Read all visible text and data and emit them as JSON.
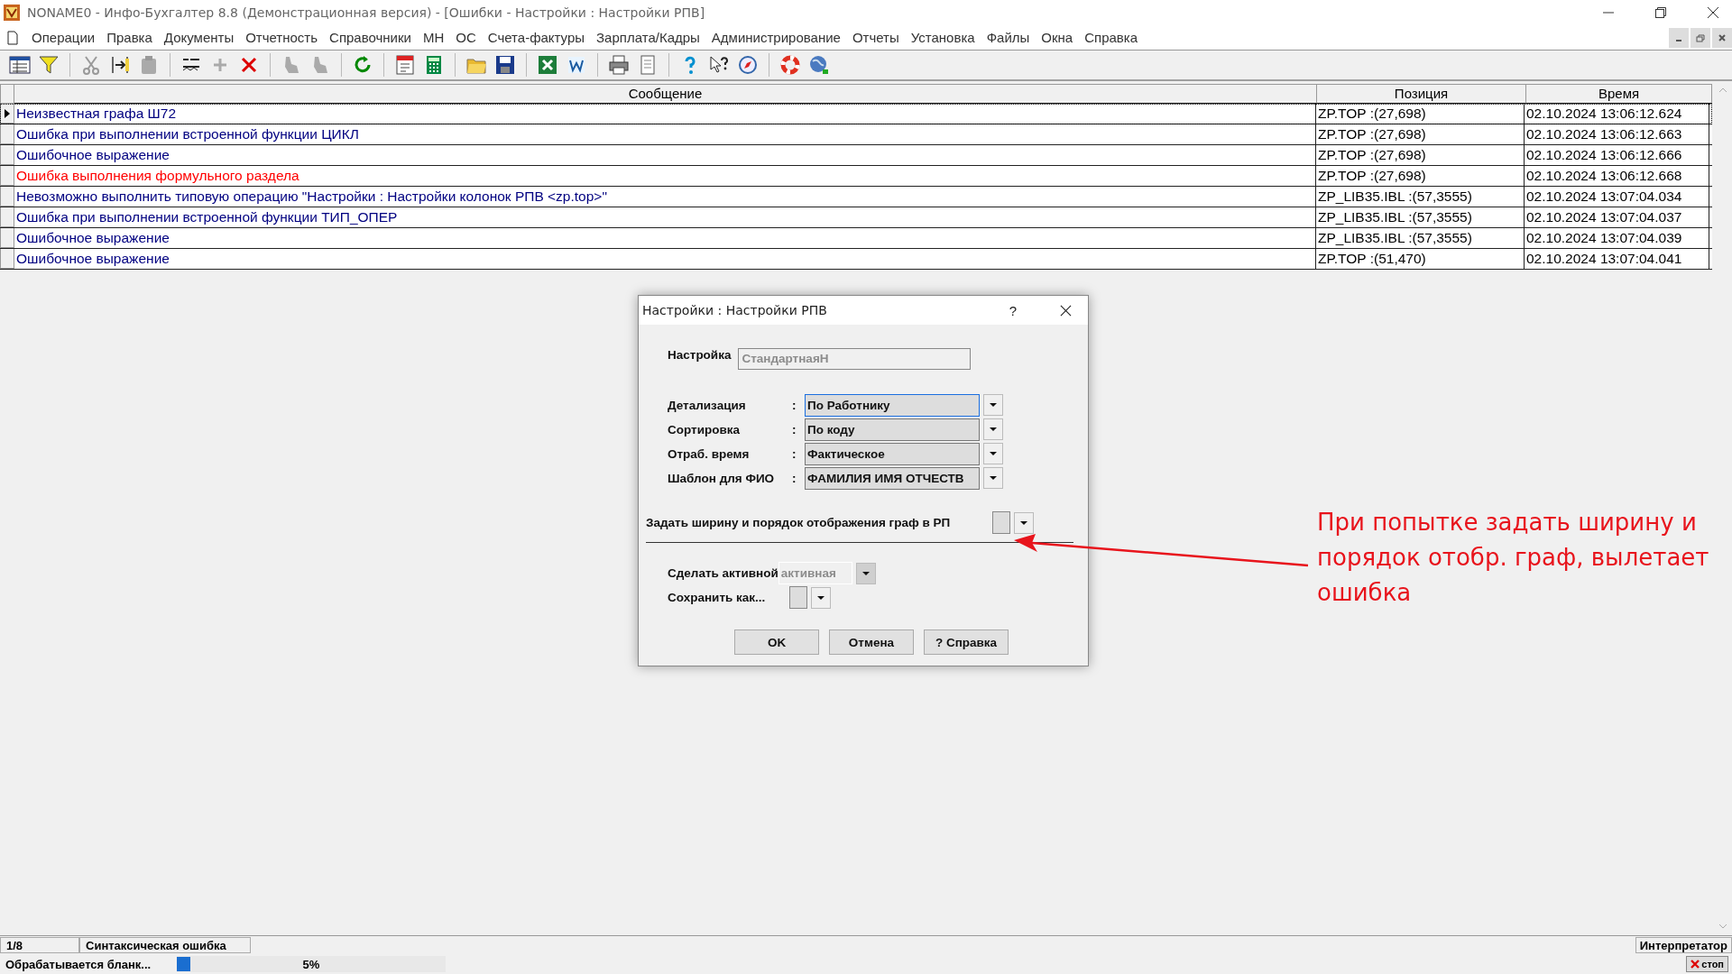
{
  "window": {
    "title": "NONAME0 - Инфо-Бухгалтер 8.8 (Демонстрационная версия) - [Ошибки - Настройки : Настройки РПВ]"
  },
  "menu": [
    "Операции",
    "Правка",
    "Документы",
    "Отчетность",
    "Справочники",
    "МН",
    "ОС",
    "Счета-фактуры",
    "Зарплата/Кадры",
    "Администрирование",
    "Отчеты",
    "Установка",
    "Файлы",
    "Окна",
    "Справка"
  ],
  "table": {
    "columns": [
      "Сообщение",
      "Позиция",
      "Время"
    ],
    "rows": [
      {
        "message": "Неизвестная графа Ш72",
        "position": "ZP.TOP :(27,698)",
        "time": "02.10.2024 13:06:12.624",
        "color": "#000080",
        "selected": true
      },
      {
        "message": "Ошибка при выполнении встроенной функции ЦИКЛ",
        "position": "ZP.TOP :(27,698)",
        "time": "02.10.2024 13:06:12.663",
        "color": "#000080",
        "selected": false
      },
      {
        "message": "Ошибочное выражение",
        "position": "ZP.TOP :(27,698)",
        "time": "02.10.2024 13:06:12.666",
        "color": "#000080",
        "selected": false
      },
      {
        "message": "Ошибка выполнения формульного раздела",
        "position": "ZP.TOP :(27,698)",
        "time": "02.10.2024 13:06:12.668",
        "color": "#ff0000",
        "selected": false
      },
      {
        "message": "Невозможно выполнить типовую операцию \"Настройки : Настройки колонок РПВ <zp.top>\"",
        "position": "ZP_LIB35.IBL :(57,3555)",
        "time": "02.10.2024 13:07:04.034",
        "color": "#000080",
        "selected": false
      },
      {
        "message": "Ошибка при выполнении встроенной функции ТИП_ОПЕР",
        "position": "ZP_LIB35.IBL :(57,3555)",
        "time": "02.10.2024 13:07:04.037",
        "color": "#000080",
        "selected": false
      },
      {
        "message": "Ошибочное выражение",
        "position": "ZP_LIB35.IBL :(57,3555)",
        "time": "02.10.2024 13:07:04.039",
        "color": "#000080",
        "selected": false
      },
      {
        "message": "Ошибочное выражение",
        "position": "ZP.TOP :(51,470)",
        "time": "02.10.2024 13:07:04.041",
        "color": "#000080",
        "selected": false
      }
    ]
  },
  "dialog": {
    "title": "Настройки : Настройки РПВ",
    "help_glyph": "?",
    "setting": {
      "label": "Настройка",
      "value": "СтандартнаяН",
      "disabled": true
    },
    "combos": [
      {
        "label": "Детализация",
        "colon": ":",
        "value": "По Работнику",
        "focused": true
      },
      {
        "label": "Сортировка",
        "colon": ":",
        "value": "По коду",
        "focused": false
      },
      {
        "label": "Отраб. время",
        "colon": ":",
        "value": "Фактическое",
        "focused": false
      },
      {
        "label": "Шаблон для ФИО",
        "colon": ":",
        "value": "ФАМИЛИЯ ИМЯ ОТЧЕСТВ",
        "focused": false
      }
    ],
    "columns_setup": {
      "label": "Задать ширину и порядок отображения граф в РП"
    },
    "activate": {
      "label": "Сделать активной",
      "value": "активная",
      "disabled": true
    },
    "save_as": {
      "label": "Сохранить как..."
    },
    "buttons": [
      "OK",
      "Отмена",
      "? Справка"
    ]
  },
  "annotation": {
    "lines": [
      "При попытке задать ширину и",
      "порядок отобр. граф, вылетает",
      "ошибка"
    ]
  },
  "status": {
    "counter": "1/8",
    "message": "Синтаксическая ошибка",
    "mode": "Интерпретатор",
    "task": "Обрабатывается бланк...",
    "progress": {
      "level": 0.05,
      "reading": "5%"
    },
    "stop": "стоп"
  }
}
